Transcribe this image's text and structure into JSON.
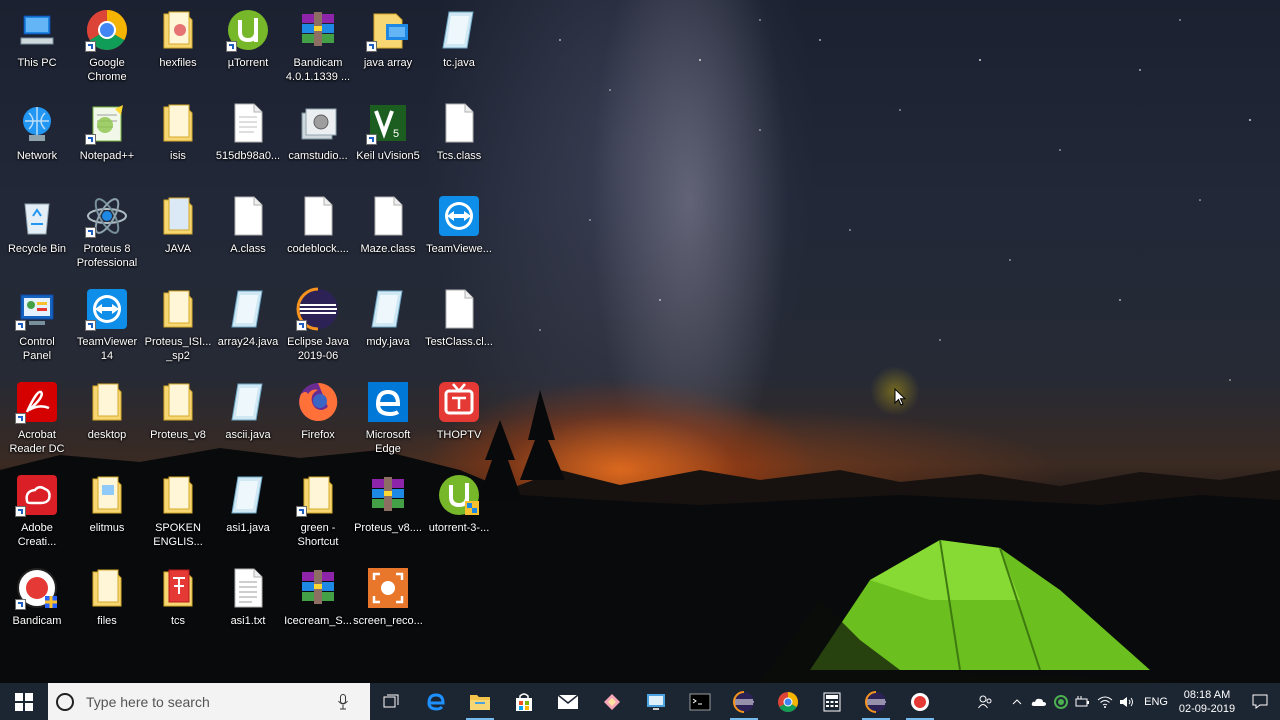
{
  "desktop": {
    "icons": [
      {
        "label": "This PC"
      },
      {
        "label": "Google\nChrome"
      },
      {
        "label": "hexfiles"
      },
      {
        "label": "µTorrent"
      },
      {
        "label": "Bandicam\n4.0.1.1339 ..."
      },
      {
        "label": "java array"
      },
      {
        "label": "tc.java"
      },
      {
        "label": "Network"
      },
      {
        "label": "Notepad++"
      },
      {
        "label": "isis"
      },
      {
        "label": "515db98a0..."
      },
      {
        "label": "camstudio..."
      },
      {
        "label": "Keil uVision5"
      },
      {
        "label": "Tcs.class"
      },
      {
        "label": "Recycle Bin"
      },
      {
        "label": "Proteus 8\nProfessional"
      },
      {
        "label": "JAVA"
      },
      {
        "label": "A.class"
      },
      {
        "label": "codeblock...."
      },
      {
        "label": "Maze.class"
      },
      {
        "label": "TeamViewe..."
      },
      {
        "label": "Control\nPanel"
      },
      {
        "label": "TeamViewer\n14"
      },
      {
        "label": "Proteus_ISI...\n_sp2"
      },
      {
        "label": "array24.java"
      },
      {
        "label": "Eclipse Java\n2019-06"
      },
      {
        "label": "mdy.java"
      },
      {
        "label": "TestClass.cl..."
      },
      {
        "label": "Acrobat\nReader DC"
      },
      {
        "label": "desktop"
      },
      {
        "label": "Proteus_v8"
      },
      {
        "label": "ascii.java"
      },
      {
        "label": "Firefox"
      },
      {
        "label": "Microsoft\nEdge"
      },
      {
        "label": "THOPTV"
      },
      {
        "label": "Adobe\nCreati..."
      },
      {
        "label": "elitmus"
      },
      {
        "label": "SPOKEN\nENGLIS..."
      },
      {
        "label": "asi1.java"
      },
      {
        "label": "green -\nShortcut"
      },
      {
        "label": "Proteus_v8...."
      },
      {
        "label": "utorrent-3-..."
      },
      {
        "label": "Bandicam"
      },
      {
        "label": "files"
      },
      {
        "label": "tcs"
      },
      {
        "label": "asi1.txt"
      },
      {
        "label": "Icecream_S..."
      },
      {
        "label": "screen_reco..."
      }
    ]
  },
  "taskbar": {
    "search_placeholder": "Type here to search",
    "apps": [
      "task-view",
      "edge",
      "file-explorer",
      "store",
      "mail",
      "sticky-notes",
      "control-panel",
      "command-prompt",
      "eclipse",
      "chrome",
      "calculator",
      "eclipse-2",
      "bandicam-record"
    ],
    "tray": {
      "language": "ENG",
      "time": "08:18 AM",
      "date": "02-09-2019"
    }
  },
  "colors": {
    "taskbar_bg": "#1c2532",
    "accent": "#76b9ed"
  }
}
